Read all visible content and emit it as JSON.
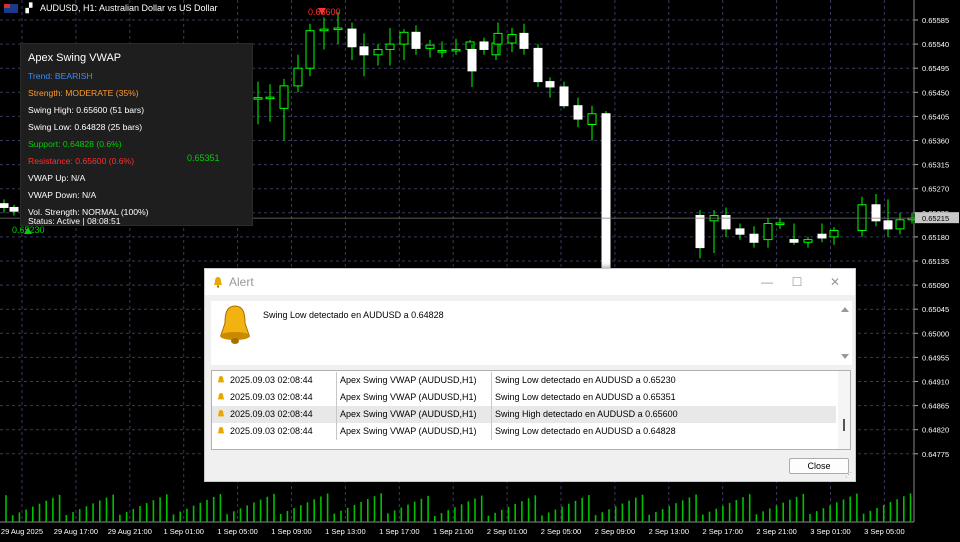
{
  "window": {
    "symbol_title": "AUDUSD, H1:  Australian Dollar vs US Dollar"
  },
  "colors": {
    "background": "#000000",
    "bull_candle": "#ffffff",
    "bear_candle": "#ffffff",
    "wick": "#00ff00",
    "grid": "#3a3a5a",
    "volume": "#00c000",
    "trend": "#3b8cff",
    "strength": "#ff9a2a",
    "support": "#00d000",
    "resistance": "#ff3030"
  },
  "panel": {
    "title": "Apex Swing VWAP",
    "trend": "Trend: BEARISH",
    "strength": "Strength: MODERATE (35%)",
    "swing_high": "Swing High: 0.65600 (51 bars)",
    "swing_low": "Swing Low: 0.64828 (25 bars)",
    "support": "Support: 0.64828 (0.6%)",
    "resistance": "Resistance: 0.65600 (0.6%)",
    "vwap_up": "VWAP Up: N/A",
    "vwap_down": "VWAP Down: N/A",
    "vol_strength": "Vol. Strength: NORMAL (100%)",
    "status": "Status: Active | 08:08:51"
  },
  "chart_labels": {
    "high_marker": "0.65600",
    "low_marker_1": "0.65230",
    "low_marker_2": "0.65351",
    "current_price": "0.65215"
  },
  "price_axis": [
    "0.65585",
    "0.65540",
    "0.65495",
    "0.65450",
    "0.65405",
    "0.65360",
    "0.65315",
    "0.65270",
    "0.65225",
    "0.65180",
    "0.65135",
    "0.65090",
    "0.65045",
    "0.65000",
    "0.64955",
    "0.64910",
    "0.64865",
    "0.64820",
    "0.64775"
  ],
  "time_axis": [
    "29 Aug 2025",
    "29 Aug 17:00",
    "29 Aug 21:00",
    "1 Sep 01:00",
    "1 Sep 05:00",
    "1 Sep 09:00",
    "1 Sep 13:00",
    "1 Sep 17:00",
    "1 Sep 21:00",
    "2 Sep 01:00",
    "2 Sep 05:00",
    "2 Sep 09:00",
    "2 Sep 13:00",
    "2 Sep 17:00",
    "2 Sep 21:00",
    "3 Sep 01:00",
    "3 Sep 05:00"
  ],
  "candles": [
    {
      "o": 0.65242,
      "h": 0.6525,
      "l": 0.65225,
      "c": 0.65235
    },
    {
      "o": 0.65235,
      "h": 0.6524,
      "l": 0.6522,
      "c": 0.65228
    },
    {
      "o": 0.6544,
      "h": 0.6547,
      "l": 0.6539,
      "c": 0.6544
    },
    {
      "o": 0.6544,
      "h": 0.65465,
      "l": 0.65395,
      "c": 0.65441
    },
    {
      "o": 0.6542,
      "h": 0.65475,
      "l": 0.6536,
      "c": 0.65462
    },
    {
      "o": 0.65462,
      "h": 0.6552,
      "l": 0.6545,
      "c": 0.65495
    },
    {
      "o": 0.65495,
      "h": 0.65578,
      "l": 0.6548,
      "c": 0.65565
    },
    {
      "o": 0.65565,
      "h": 0.6559,
      "l": 0.6553,
      "c": 0.65568
    },
    {
      "o": 0.65568,
      "h": 0.656,
      "l": 0.6554,
      "c": 0.6557
    },
    {
      "o": 0.65568,
      "h": 0.6558,
      "l": 0.6551,
      "c": 0.65535
    },
    {
      "o": 0.65535,
      "h": 0.6556,
      "l": 0.6548,
      "c": 0.6552
    },
    {
      "o": 0.6552,
      "h": 0.6554,
      "l": 0.655,
      "c": 0.6553
    },
    {
      "o": 0.6553,
      "h": 0.6557,
      "l": 0.655,
      "c": 0.6554
    },
    {
      "o": 0.6554,
      "h": 0.65568,
      "l": 0.6551,
      "c": 0.65562
    },
    {
      "o": 0.65562,
      "h": 0.65575,
      "l": 0.6552,
      "c": 0.65532
    },
    {
      "o": 0.65532,
      "h": 0.65548,
      "l": 0.65515,
      "c": 0.65538
    },
    {
      "o": 0.65525,
      "h": 0.65545,
      "l": 0.65515,
      "c": 0.65528
    },
    {
      "o": 0.65528,
      "h": 0.6555,
      "l": 0.6552,
      "c": 0.6553
    },
    {
      "o": 0.6553,
      "h": 0.65548,
      "l": 0.6551,
      "c": 0.65544
    },
    {
      "o": 0.65544,
      "h": 0.65552,
      "l": 0.6552,
      "c": 0.6553
    },
    {
      "o": 0.6553,
      "h": 0.6554,
      "l": 0.6546,
      "c": 0.6549
    },
    {
      "o": 0.6552,
      "h": 0.65548,
      "l": 0.6551,
      "c": 0.65542
    },
    {
      "o": 0.65542,
      "h": 0.6557,
      "l": 0.65525,
      "c": 0.65558
    },
    {
      "o": 0.6554,
      "h": 0.6558,
      "l": 0.6552,
      "c": 0.6556
    },
    {
      "o": 0.6556,
      "h": 0.65578,
      "l": 0.6552,
      "c": 0.65532
    },
    {
      "o": 0.65532,
      "h": 0.6554,
      "l": 0.6546,
      "c": 0.6547
    },
    {
      "o": 0.6547,
      "h": 0.65478,
      "l": 0.6544,
      "c": 0.6546
    },
    {
      "o": 0.6546,
      "h": 0.6547,
      "l": 0.6542,
      "c": 0.65425
    },
    {
      "o": 0.65425,
      "h": 0.6544,
      "l": 0.65385,
      "c": 0.654
    },
    {
      "o": 0.654,
      "h": 0.65425,
      "l": 0.6538,
      "c": 0.6539
    },
    {
      "o": 0.6539,
      "h": 0.654,
      "l": 0.6537,
      "c": 0.6538
    },
    {
      "o": 0.6539,
      "h": 0.65425,
      "l": 0.6536,
      "c": 0.6541
    },
    {
      "o": 0.6541,
      "h": 0.65415,
      "l": 0.6508,
      "c": 0.651
    },
    {
      "o": 0.6522,
      "h": 0.6523,
      "l": 0.6514,
      "c": 0.6516
    },
    {
      "o": 0.6521,
      "h": 0.6523,
      "l": 0.6515,
      "c": 0.6522
    },
    {
      "o": 0.6522,
      "h": 0.65235,
      "l": 0.6518,
      "c": 0.65195
    },
    {
      "o": 0.65195,
      "h": 0.65205,
      "l": 0.65175,
      "c": 0.65185
    },
    {
      "o": 0.65185,
      "h": 0.652,
      "l": 0.6516,
      "c": 0.6517
    },
    {
      "o": 0.65175,
      "h": 0.65215,
      "l": 0.6516,
      "c": 0.65205
    },
    {
      "o": 0.65205,
      "h": 0.65215,
      "l": 0.65195,
      "c": 0.65206
    },
    {
      "o": 0.65175,
      "h": 0.65205,
      "l": 0.65165,
      "c": 0.6517
    },
    {
      "o": 0.6517,
      "h": 0.6518,
      "l": 0.6516,
      "c": 0.65175
    },
    {
      "o": 0.65185,
      "h": 0.65205,
      "l": 0.6517,
      "c": 0.65178
    },
    {
      "o": 0.6518,
      "h": 0.65198,
      "l": 0.65165,
      "c": 0.65192
    },
    {
      "o": 0.65192,
      "h": 0.65255,
      "l": 0.6518,
      "c": 0.6524
    },
    {
      "o": 0.6524,
      "h": 0.6526,
      "l": 0.652,
      "c": 0.6521
    },
    {
      "o": 0.6521,
      "h": 0.6525,
      "l": 0.6518,
      "c": 0.65195
    },
    {
      "o": 0.65195,
      "h": 0.65225,
      "l": 0.65185,
      "c": 0.65212
    },
    {
      "o": 0.65212,
      "h": 0.65225,
      "l": 0.65205,
      "c": 0.65215
    }
  ],
  "alert": {
    "title": "Alert",
    "message": "Swing Low detectado en AUDUSD a 0.64828",
    "close_label": "Close",
    "minimize": "—",
    "maximize": "☐",
    "close_x": "✕",
    "rows": [
      {
        "time": "2025.09.03 02:08:44",
        "source": "Apex Swing VWAP (AUDUSD,H1)",
        "message": "Swing Low detectado en AUDUSD a 0.65230"
      },
      {
        "time": "2025.09.03 02:08:44",
        "source": "Apex Swing VWAP (AUDUSD,H1)",
        "message": "Swing Low detectado en AUDUSD a 0.65351"
      },
      {
        "time": "2025.09.03 02:08:44",
        "source": "Apex Swing VWAP (AUDUSD,H1)",
        "message": "Swing High detectado en AUDUSD a 0.65600"
      },
      {
        "time": "2025.09.03 02:08:44",
        "source": "Apex Swing VWAP (AUDUSD,H1)",
        "message": "Swing Low detectado en AUDUSD a 0.64828"
      }
    ]
  }
}
